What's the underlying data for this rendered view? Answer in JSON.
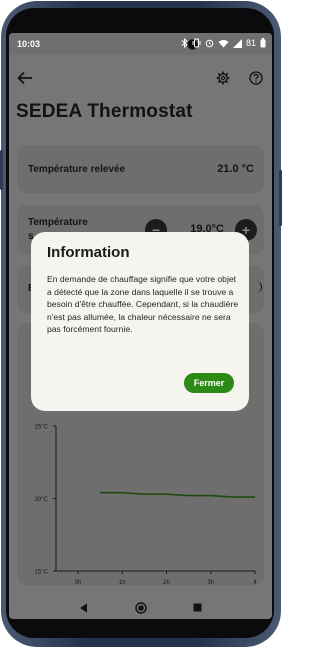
{
  "status_bar": {
    "time": "10:03",
    "battery": "81"
  },
  "app_bar": {
    "back_icon": "arrow-left-icon",
    "settings_icon": "gear-icon",
    "help_icon": "question-circle-icon"
  },
  "page": {
    "title": "SEDEA Thermostat"
  },
  "cards": {
    "measured_temp": {
      "label": "Température relevée",
      "value": "21.0 °C"
    },
    "setpoint": {
      "label_partial": "Température",
      "label_partial_2": "s",
      "value": "19.0°C",
      "minus": "−",
      "plus": "+"
    },
    "third_row": {
      "label_partial": "E"
    }
  },
  "dialog": {
    "title": "Information",
    "body": "En demande de chauffage signifie que votre objet a détecté que la zone dans laquelle il se trouve a besoin d'être chauffée. Cependant, si la chaudière n'est pas allumée, la chaleur nécessaire ne sera pas forcément fournie.",
    "button": "Fermer"
  },
  "chart_data": {
    "type": "line",
    "y_tick_labels": [
      "25°C",
      "20°C",
      "15°C"
    ],
    "y_ticks": [
      25,
      20,
      15
    ],
    "x_tick_labels": [
      "0h",
      "1h",
      "2h",
      "3h",
      "4"
    ],
    "ylim": [
      15,
      25
    ],
    "series": [
      {
        "color": "#1f4a12",
        "x": [
          0.5,
          1.0,
          1.5,
          2.0,
          2.5,
          3.0,
          3.5,
          4.0
        ],
        "values": [
          20.4,
          20.4,
          20.3,
          20.3,
          20.2,
          20.2,
          20.1,
          20.1
        ]
      }
    ]
  },
  "colors": {
    "accent": "#2b8a16",
    "dialog_bg": "#f6f4ee",
    "scrim_bg": "#767676"
  }
}
